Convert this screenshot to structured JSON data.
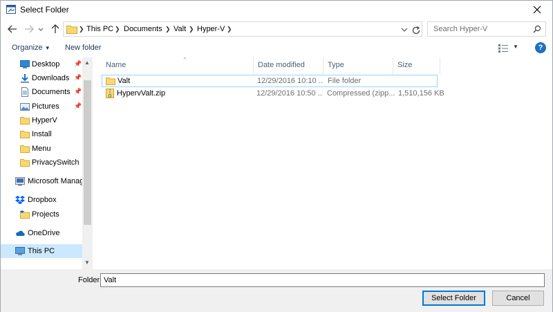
{
  "window": {
    "title": "Select Folder"
  },
  "address": {
    "crumbs": [
      "This PC",
      "Documents",
      "Valt",
      "Hyper-V"
    ]
  },
  "search": {
    "placeholder": "Search Hyper-V"
  },
  "commands": {
    "organize": "Organize",
    "new_folder": "New folder"
  },
  "nav": {
    "items": [
      {
        "label": "Desktop",
        "icon": "desktop-icon",
        "pinned": true
      },
      {
        "label": "Downloads",
        "icon": "download-icon",
        "pinned": true
      },
      {
        "label": "Documents",
        "icon": "documents-icon",
        "pinned": true
      },
      {
        "label": "Pictures",
        "icon": "pictures-icon",
        "pinned": true
      },
      {
        "label": "HyperV",
        "icon": "folder-icon",
        "pinned": false
      },
      {
        "label": "Install",
        "icon": "folder-icon",
        "pinned": false
      },
      {
        "label": "Menu",
        "icon": "folder-icon",
        "pinned": false
      },
      {
        "label": "PrivacySwitch",
        "icon": "folder-icon",
        "pinned": false
      },
      {
        "label": "Microsoft Manage",
        "icon": "management-console-icon",
        "pinned": false
      },
      {
        "label": "Dropbox",
        "icon": "dropbox-icon",
        "pinned": false
      },
      {
        "label": "Projects",
        "icon": "projects-icon",
        "pinned": false
      },
      {
        "label": "OneDrive",
        "icon": "onedrive-icon",
        "pinned": false
      },
      {
        "label": "This PC",
        "icon": "computer-icon",
        "pinned": false,
        "selected": true
      }
    ]
  },
  "columns": {
    "name": "Name",
    "date": "Date modified",
    "type": "Type",
    "size": "Size"
  },
  "files": [
    {
      "name": "Valt",
      "date": "12/29/2016 10:10 ...",
      "type": "File folder",
      "size": "",
      "icon": "folder-icon"
    },
    {
      "name": "HypervValt.zip",
      "date": "12/29/2016 10:50 ...",
      "type": "Compressed (zipp...",
      "size": "1,510,156 KB",
      "icon": "zip-folder-icon"
    }
  ],
  "bottom": {
    "folder_label": "Folder:",
    "folder_value": "Valt",
    "select_label": "Select Folder",
    "cancel_label": "Cancel"
  },
  "colors": {
    "accent": "#0078d7",
    "selection": "#cce8ff",
    "folder": "#f8d775"
  }
}
